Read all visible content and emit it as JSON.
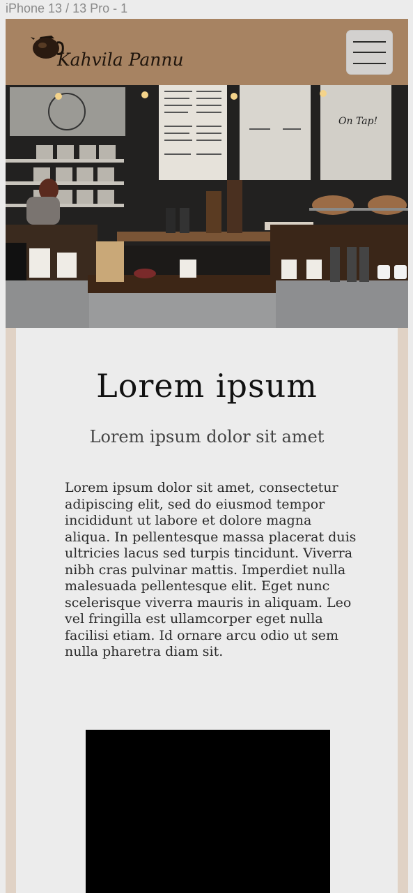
{
  "frame": {
    "label": "iPhone 13 / 13 Pro - 1"
  },
  "header": {
    "brand": "Kahvila Pannu",
    "logo_icon": "coffee-pot-icon",
    "menu_icon": "hamburger-menu-icon",
    "bg_color": "#a78362"
  },
  "hero": {
    "image": "coffee-shop-counter-photo"
  },
  "main": {
    "title": "Lorem ipsum",
    "subtitle": "Lorem ipsum dolor sit amet",
    "body": "Lorem ipsum dolor sit amet, consectetur adipiscing elit, sed do eiusmod tempor incididunt ut labore et dolore magna aliqua. In pellentesque massa placerat duis ultricies lacus sed turpis tincidunt. Viverra nibh cras pulvinar mattis. Imperdiet nulla malesuada pellentesque elit. Eget nunc scelerisque viverra mauris in aliquam. Leo vel fringilla est ullamcorper eget nulla facilisi etiam. Id ornare arcu odio ut sem nulla pharetra diam sit."
  },
  "colors": {
    "side_rail": "#e0d2c5",
    "content_bg": "#ececec"
  }
}
